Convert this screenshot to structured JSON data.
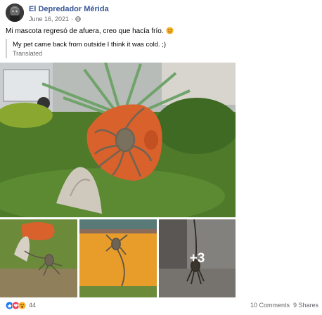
{
  "post": {
    "page_name": "El Depredador Mérida",
    "date": "June 16, 2021",
    "privacy_icon": "globe-icon",
    "text": "Mi mascota regresó de afuera, creo que hacía frío.",
    "text_emoji": "winking-face-emoji",
    "translation": "My pet came back from outside I think it was cold. ;)",
    "translated_label": "Translated"
  },
  "photos": {
    "more_count": "+3"
  },
  "footer": {
    "reaction_icons": [
      "like-icon",
      "love-icon",
      "wow-icon"
    ],
    "reaction_count": "44",
    "comments": "10 Comments",
    "shares": "9 Shares"
  },
  "colors": {
    "link": "#385898",
    "secondary_text": "#65676b",
    "like_blue": "#1877f2",
    "love_red": "#f33e58",
    "wow_yellow": "#f7b125",
    "planter_orange": "#d9612c"
  }
}
